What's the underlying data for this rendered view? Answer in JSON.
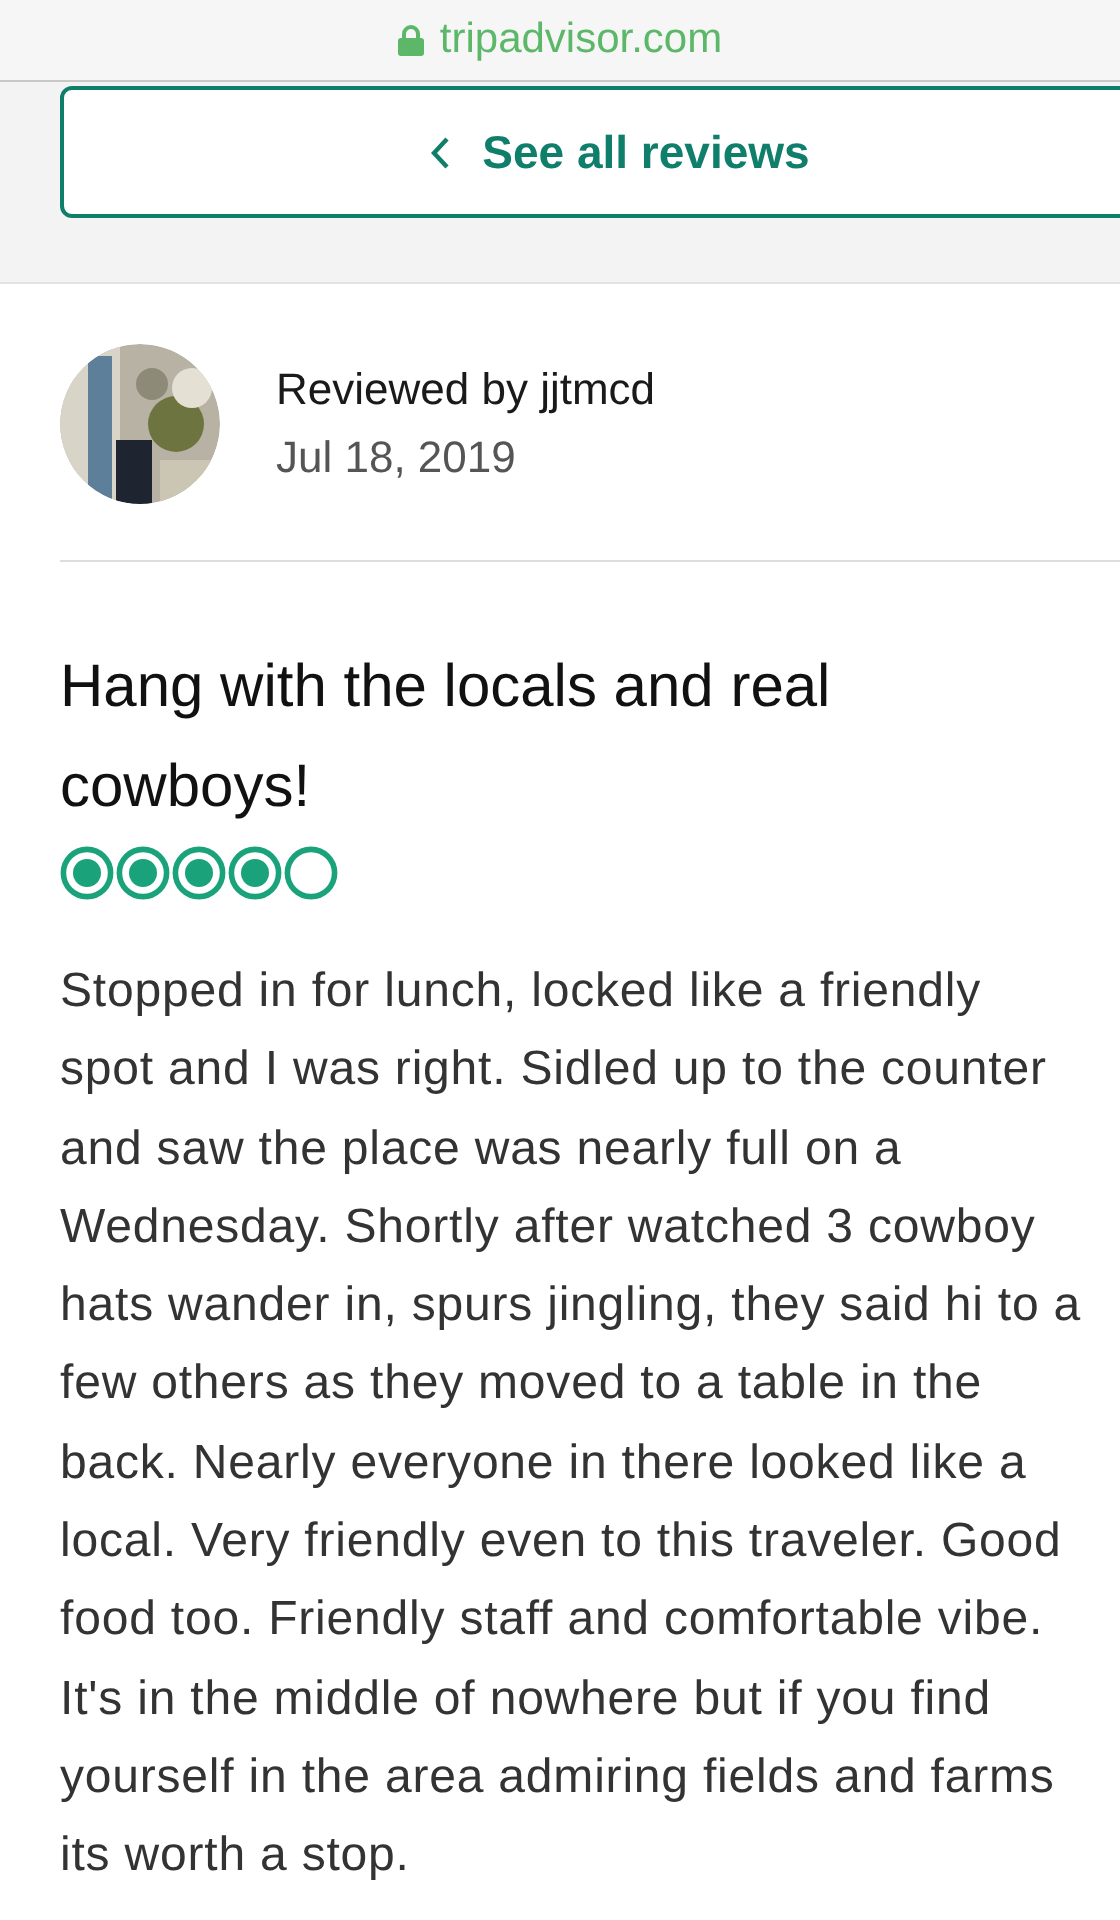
{
  "address_bar": {
    "url": "tripadvisor.com",
    "secure": true
  },
  "back_button": {
    "label": "See all reviews"
  },
  "review": {
    "reviewer": "Reviewed by jjtmcd",
    "date": "Jul 18, 2019",
    "title": "Hang with the locals and real cowboys!",
    "stars": 4,
    "body_lines": [
      "Stopped in for lunch, locked like a friendly",
      "spot and I was right. Sidled up to the counter",
      "and saw the place was nearly full on a",
      "Wednesday. Shortly after watched 3 cowboy",
      "hats wander in, spurs jingling, they said hi to a",
      "few others as they moved to a table in the",
      "back. Nearly everyone in there looked like a",
      "local. Very friendly even to this traveler. Good",
      "food too. Friendly staff and comfortable vibe.",
      "It's in the middle of nowhere but if you find",
      "yourself in the area admiring fields and farms",
      "its worth a stop."
    ]
  }
}
